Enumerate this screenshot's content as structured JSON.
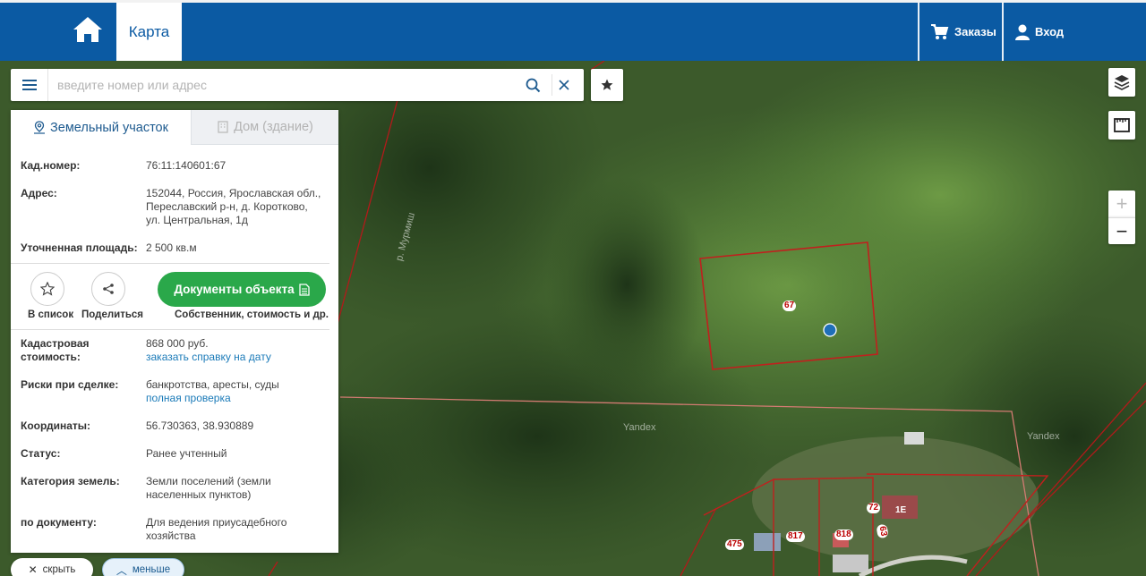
{
  "header": {
    "home_label": "",
    "tab_map": "Карта",
    "orders": "Заказы",
    "login": "Вход"
  },
  "search": {
    "placeholder": "введите номер или адрес"
  },
  "panel": {
    "tab_land": "Земельный участок",
    "tab_house": "Дом (здание)",
    "cad_label": "Кад.номер:",
    "cad_value": "76:11:140601:67",
    "address_label": "Адрес:",
    "address_value": "152044, Россия, Ярославская обл., Переславский р-н, д. Коротково, ул. Центральная, 1д",
    "area_label": "Уточненная площадь:",
    "area_value": "2 500 кв.м",
    "to_list": "В список",
    "share": "Поделиться",
    "docs_button": "Документы объекта",
    "docs_caption": "Собственник, стоимость и др.",
    "cost_label": "Кадастровая стоимость:",
    "cost_value": "868 000 руб.",
    "cost_link": "заказать справку на дату",
    "risks_label": "Риски при сделке:",
    "risks_value": "банкротства, аресты, суды",
    "risks_link": "полная проверка",
    "coords_label": "Координаты:",
    "coords_value": "56.730363, 38.930889",
    "status_label": "Статус:",
    "status_value": "Ранее учтенный",
    "category_label": "Категория земель:",
    "category_value": "Земли поселений (земли населенных пунктов)",
    "doc_label": "по документу:",
    "doc_value": "Для ведения приусадебного хозяйства"
  },
  "bottom": {
    "hide": "скрыть",
    "less": "меньше"
  },
  "map": {
    "river_label": "р. Мурмиш",
    "watermark_1": "Yandex",
    "watermark_2": "Yandex",
    "plot_67": "67",
    "plot_475": "475",
    "plot_817": "817",
    "plot_818": "818",
    "plot_72": "72",
    "plot_1e": "1Е",
    "plot_63": "63"
  },
  "colors": {
    "header_blue": "#0b5aa3",
    "docs_green": "#2aa84a",
    "link_blue": "#1a7ab8",
    "parcel_red": "#c0201e"
  }
}
